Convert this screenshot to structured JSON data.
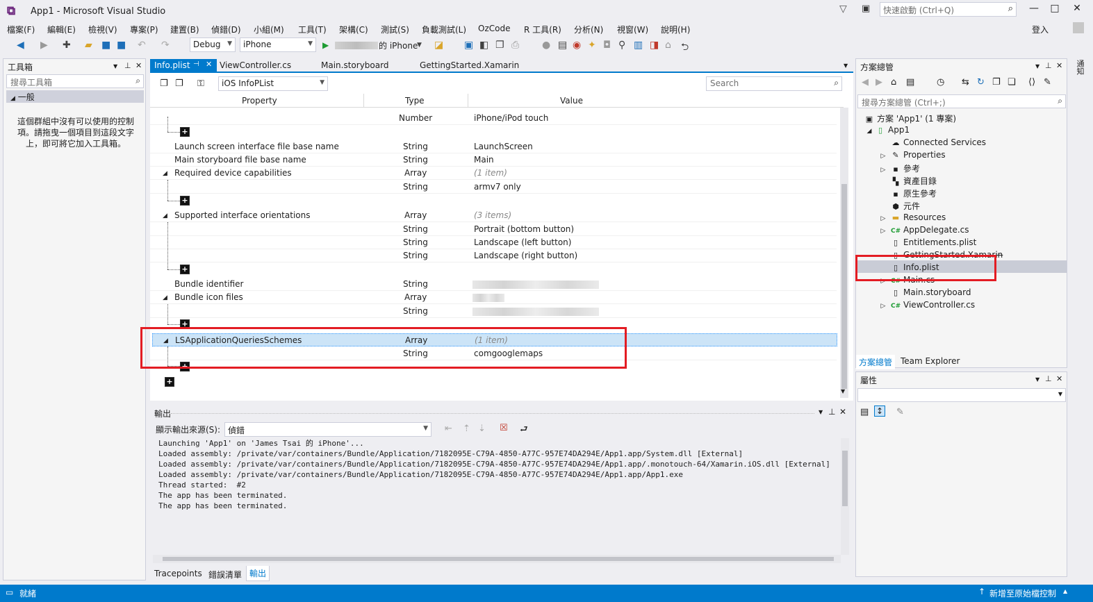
{
  "window": {
    "title": "App1 - Microsoft Visual Studio",
    "quick_launch_placeholder": "快速啟動 (Ctrl+Q)",
    "login": "登入"
  },
  "menu": [
    "檔案(F)",
    "編輯(E)",
    "檢視(V)",
    "專案(P)",
    "建置(B)",
    "偵錯(D)",
    "小組(M)",
    "工具(T)",
    "架構(C)",
    "測試(S)",
    "負載測試(L)",
    "OzCode",
    "R 工具(R)",
    "分析(N)",
    "視窗(W)",
    "說明(H)"
  ],
  "toolbar": {
    "config": "Debug",
    "platform": "iPhone",
    "run_target": "的 iPhone"
  },
  "toolbox": {
    "title": "工具箱",
    "search_placeholder": "搜尋工具箱",
    "group": "一般",
    "empty_message": "這個群組中沒有可以使用的控制項。請拖曳一個項目到這段文字上，即可將它加入工具箱。"
  },
  "doc_tabs": [
    "Info.plist",
    "ViewController.cs",
    "Main.storyboard",
    "GettingStarted.Xamarin"
  ],
  "plist_editor": {
    "schema_dropdown": "iOS InfoPList",
    "search_placeholder": "Search",
    "columns": [
      "Property",
      "Type",
      "Value"
    ],
    "rows": [
      {
        "property": "",
        "type": "Number",
        "value": "iPhone/iPod touch"
      },
      {
        "property": "Launch screen interface file base name",
        "type": "String",
        "value": "LaunchScreen"
      },
      {
        "property": "Main storyboard file base name",
        "type": "String",
        "value": "Main"
      },
      {
        "property": "Required device capabilities",
        "type": "Array",
        "value": "(1 item)"
      },
      {
        "property": "",
        "type": "String",
        "value": "armv7 only"
      },
      {
        "property": "Supported interface orientations",
        "type": "Array",
        "value": "(3 items)"
      },
      {
        "property": "",
        "type": "String",
        "value": "Portrait (bottom button)"
      },
      {
        "property": "",
        "type": "String",
        "value": "Landscape (left button)"
      },
      {
        "property": "",
        "type": "String",
        "value": "Landscape (right button)"
      },
      {
        "property": "Bundle identifier",
        "type": "String",
        "value": ""
      },
      {
        "property": "Bundle icon files",
        "type": "Array",
        "value": ""
      },
      {
        "property": "",
        "type": "String",
        "value": ""
      },
      {
        "property": "LSApplicationQueriesSchemes",
        "type": "Array",
        "value": "(1 item)"
      },
      {
        "property": "",
        "type": "String",
        "value": "comgooglemaps"
      }
    ]
  },
  "output": {
    "title": "輸出",
    "source_label": "顯示輸出來源(S):",
    "source_value": "偵錯",
    "lines": [
      "Launching 'App1' on 'James Tsai 的 iPhone'...",
      "Loaded assembly: /private/var/containers/Bundle/Application/7182095E-C79A-4850-A77C-957E74DA294E/App1.app/System.dll [External]",
      "Loaded assembly: /private/var/containers/Bundle/Application/7182095E-C79A-4850-A77C-957E74DA294E/App1.app/.monotouch-64/Xamarin.iOS.dll [External]",
      "Loaded assembly: /private/var/containers/Bundle/Application/7182095E-C79A-4850-A77C-957E74DA294E/App1.app/App1.exe",
      "Thread started:  #2",
      "The app has been terminated.",
      "The app has been terminated."
    ],
    "bottom_tabs": [
      "Tracepoints",
      "錯誤清單",
      "輸出"
    ]
  },
  "solution_explorer": {
    "title": "方案總管",
    "search_placeholder": "搜尋方案總管 (Ctrl+;)",
    "items": [
      {
        "label": "方案 'App1' (1 專案)",
        "icon": "solution-icon"
      },
      {
        "label": "App1",
        "icon": "project-icon"
      },
      {
        "label": "Connected Services",
        "icon": "cloud-icon"
      },
      {
        "label": "Properties",
        "icon": "wrench-icon"
      },
      {
        "label": "參考",
        "icon": "reference-icon"
      },
      {
        "label": "資產目錄",
        "icon": "asset-icon"
      },
      {
        "label": "原生參考",
        "icon": "reference-icon"
      },
      {
        "label": "元件",
        "icon": "component-icon"
      },
      {
        "label": "Resources",
        "icon": "folder-icon"
      },
      {
        "label": "AppDelegate.cs",
        "icon": "csharp-icon"
      },
      {
        "label": "Entitlements.plist",
        "icon": "file-icon"
      },
      {
        "label": "GettingStarted.Xamarin",
        "icon": "file-icon"
      },
      {
        "label": "Info.plist",
        "icon": "file-icon"
      },
      {
        "label": "Main.cs",
        "icon": "csharp-icon"
      },
      {
        "label": "Main.storyboard",
        "icon": "file-icon"
      },
      {
        "label": "ViewController.cs",
        "icon": "csharp-icon"
      }
    ],
    "bottom_tabs": [
      "方案總管",
      "Team Explorer"
    ]
  },
  "properties": {
    "title": "屬性"
  },
  "status": {
    "left": "就緒",
    "right": "新增至原始檔控制"
  },
  "colors": {
    "accent": "#007acc",
    "highlight": "#e31c23",
    "selection": "#cce4f7"
  }
}
